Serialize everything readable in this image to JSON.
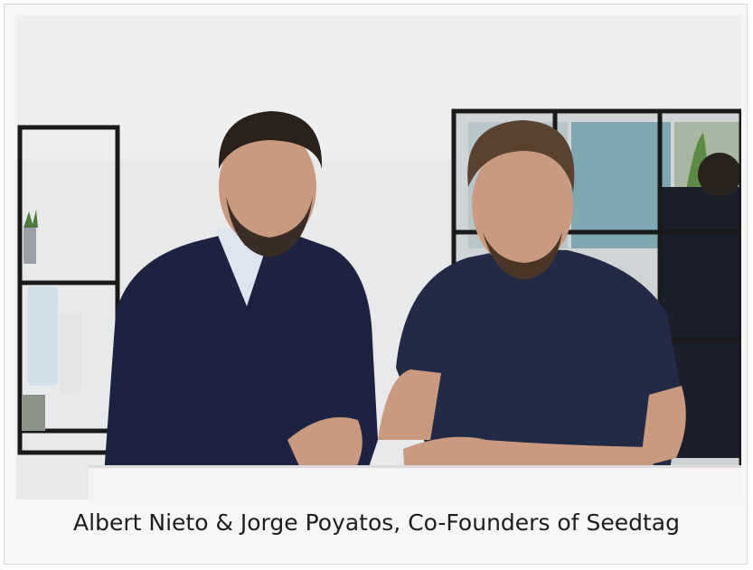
{
  "figure": {
    "caption": "Albert Nieto & Jorge Poyatos, Co-Founders of Seedtag"
  },
  "photo": {
    "subject": "two-people-portrait-photo",
    "colors": {
      "wall": "#e9eaec",
      "table": "#f4f4f4",
      "sweater": "#1c2240",
      "tshirt": "#232a45",
      "skin": "#c99a80",
      "hair": "#2b211b",
      "shelf": "#1a1a1a"
    }
  }
}
